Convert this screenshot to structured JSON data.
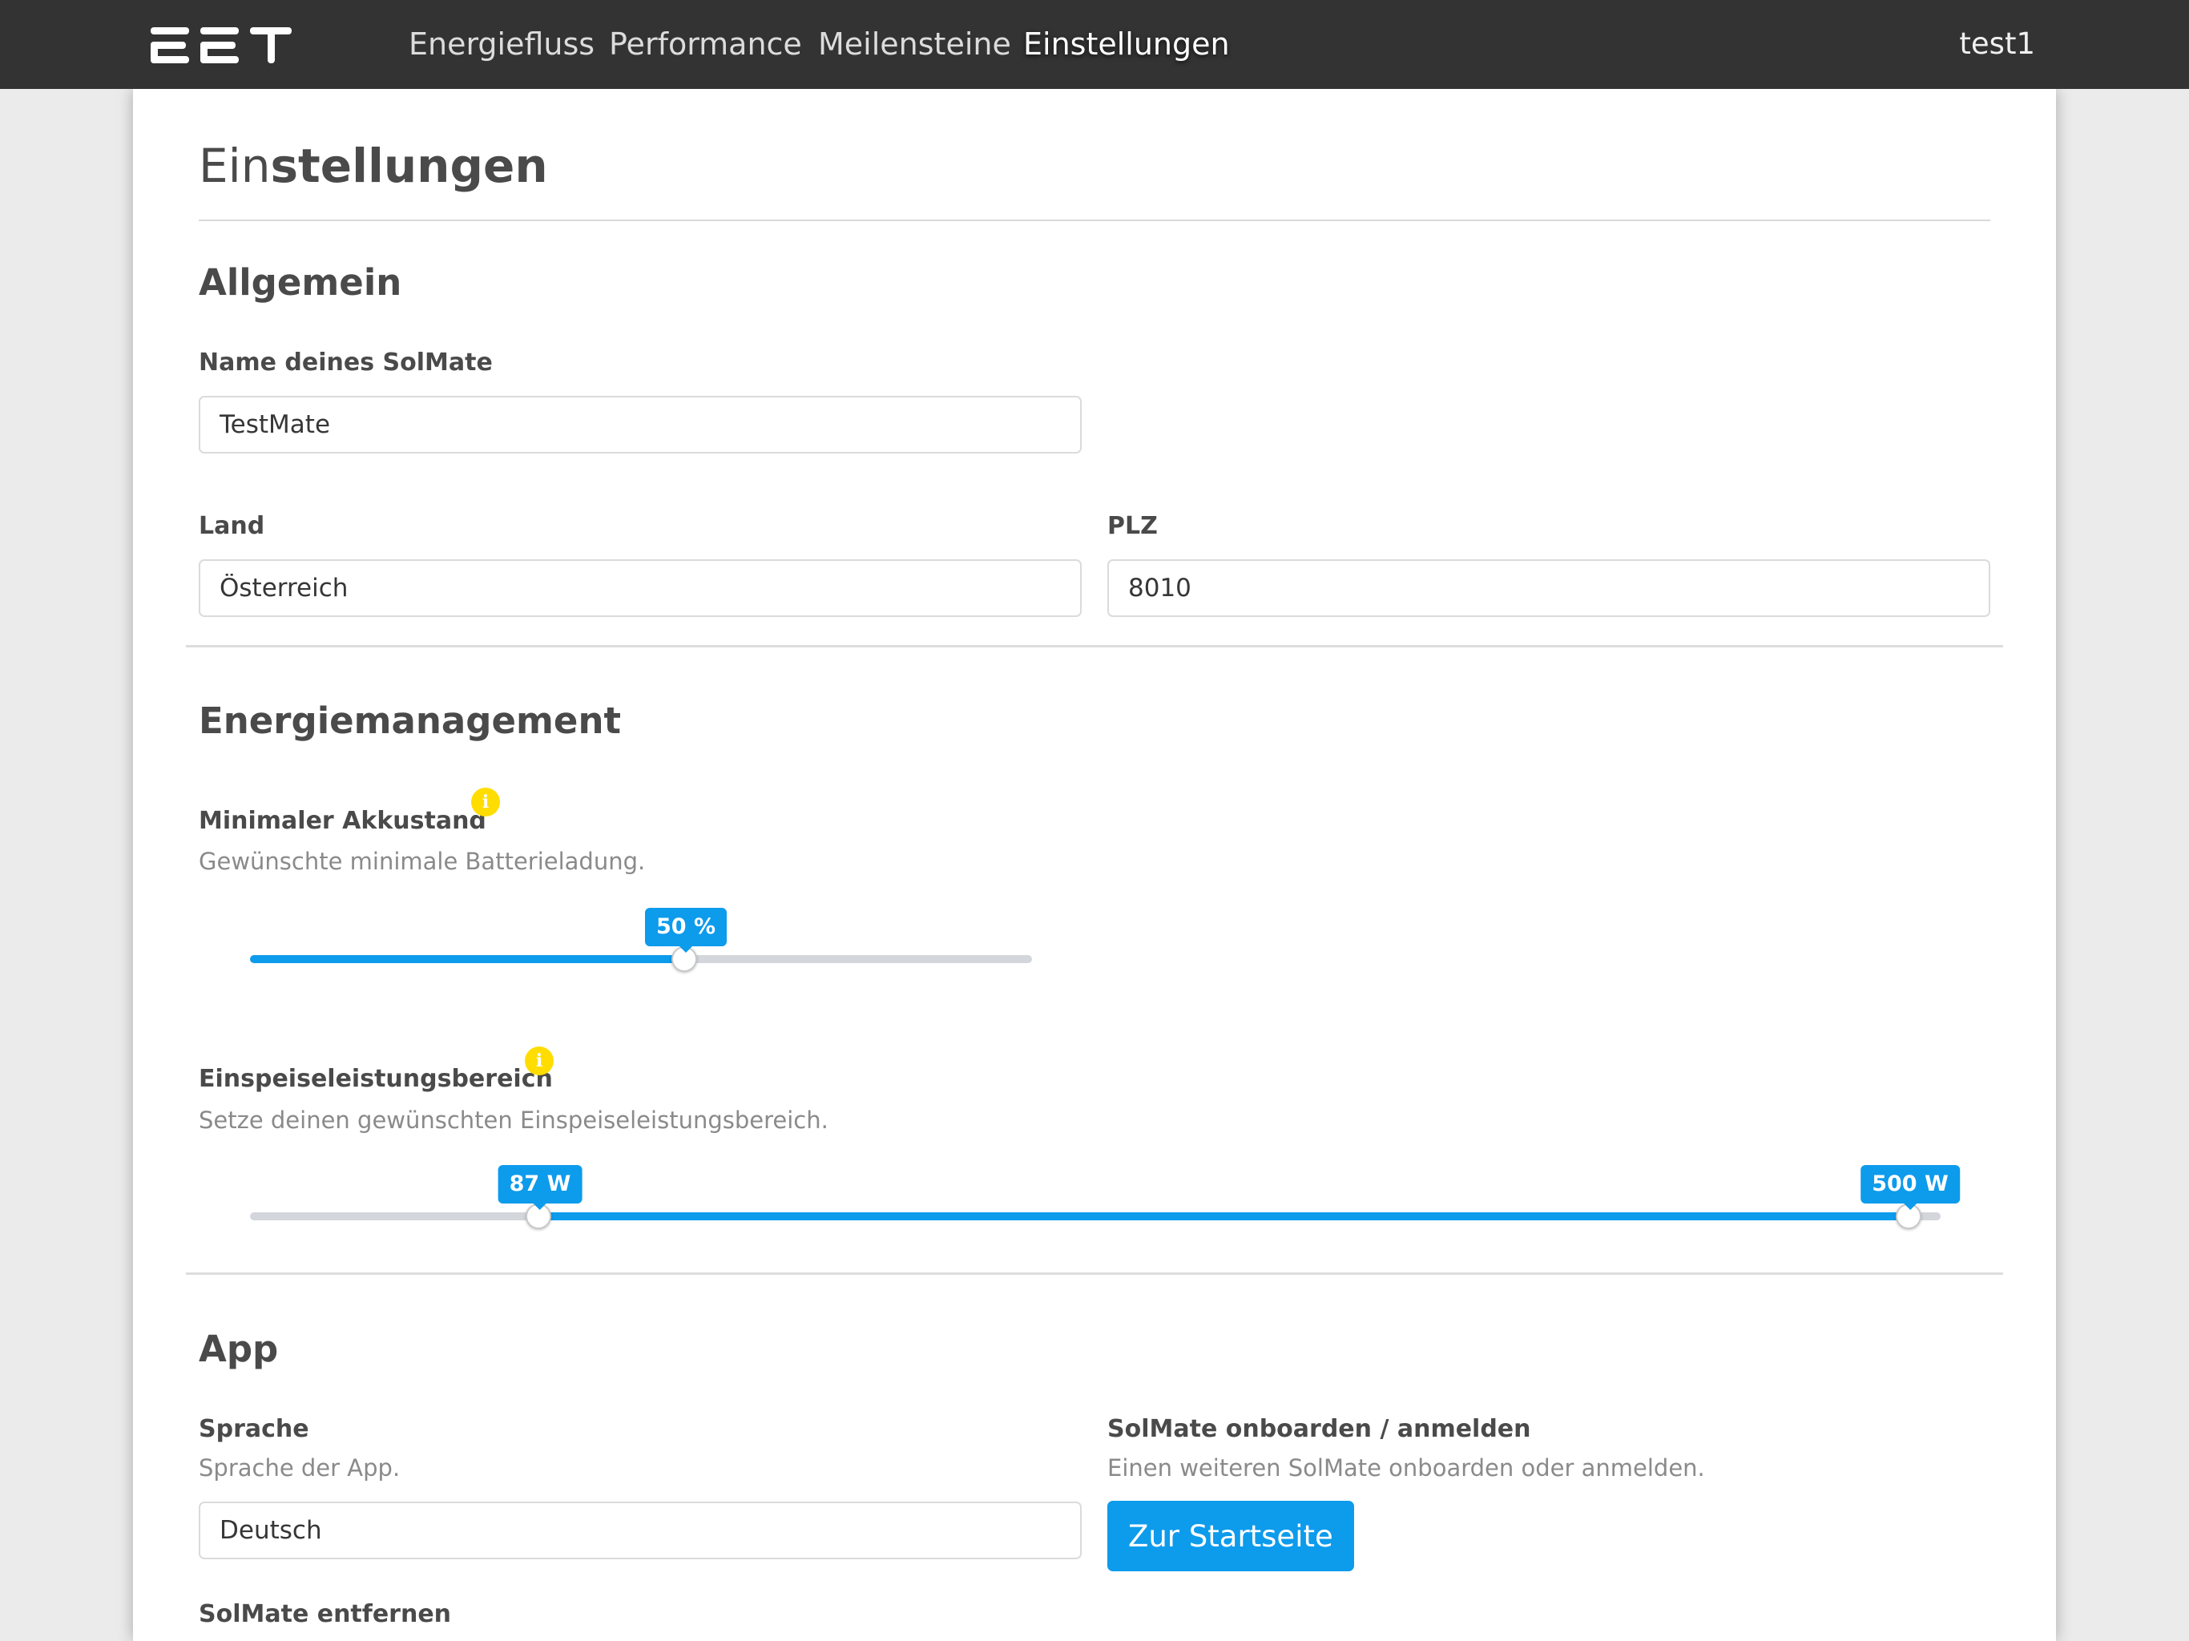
{
  "navbar": {
    "logo_text": "EET",
    "items": [
      "Energiefluss",
      "Performance",
      "Meilensteine",
      "Einstellungen"
    ],
    "active_item": "Einstellungen",
    "user": "test1"
  },
  "page": {
    "title_light": "Ein",
    "title_bold": "stellungen"
  },
  "general": {
    "title": "Allgemein",
    "name_label": "Name deines SolMate",
    "name_value": "TestMate",
    "country_label": "Land",
    "country_value": "Österreich",
    "zip_label": "PLZ",
    "zip_value": "8010"
  },
  "energy": {
    "title": "Energiemanagement",
    "min_battery": {
      "label": "Minimaler Akkustand",
      "info_icon": "info-icon",
      "help": "Gewünschte minimale Batterieladung.",
      "value": 50,
      "value_label": "50 %",
      "fill_fraction": 0.555
    },
    "feed_in": {
      "label": "Einspeiseleistungsbereich",
      "info_icon": "info-icon",
      "help": "Setze deinen gewünschten Einspeiseleistungsbereich.",
      "min_value": 87,
      "max_value": 500,
      "min_label": "87 W",
      "max_label": "500 W",
      "min_fraction": 0.174,
      "max_fraction": 1.0
    }
  },
  "app": {
    "title": "App",
    "language_label": "Sprache",
    "language_help": "Sprache der App.",
    "language_value": "Deutsch",
    "onboard_label": "SolMate onboarden / anmelden",
    "onboard_help": "Einen weiteren SolMate onboarden oder anmelden.",
    "onboard_button": "Zur Startseite",
    "remove_label": "SolMate entfernen"
  },
  "colors": {
    "accent": "#0d9bec",
    "navbar": "#333333",
    "info_badge": "#ffdd00"
  }
}
